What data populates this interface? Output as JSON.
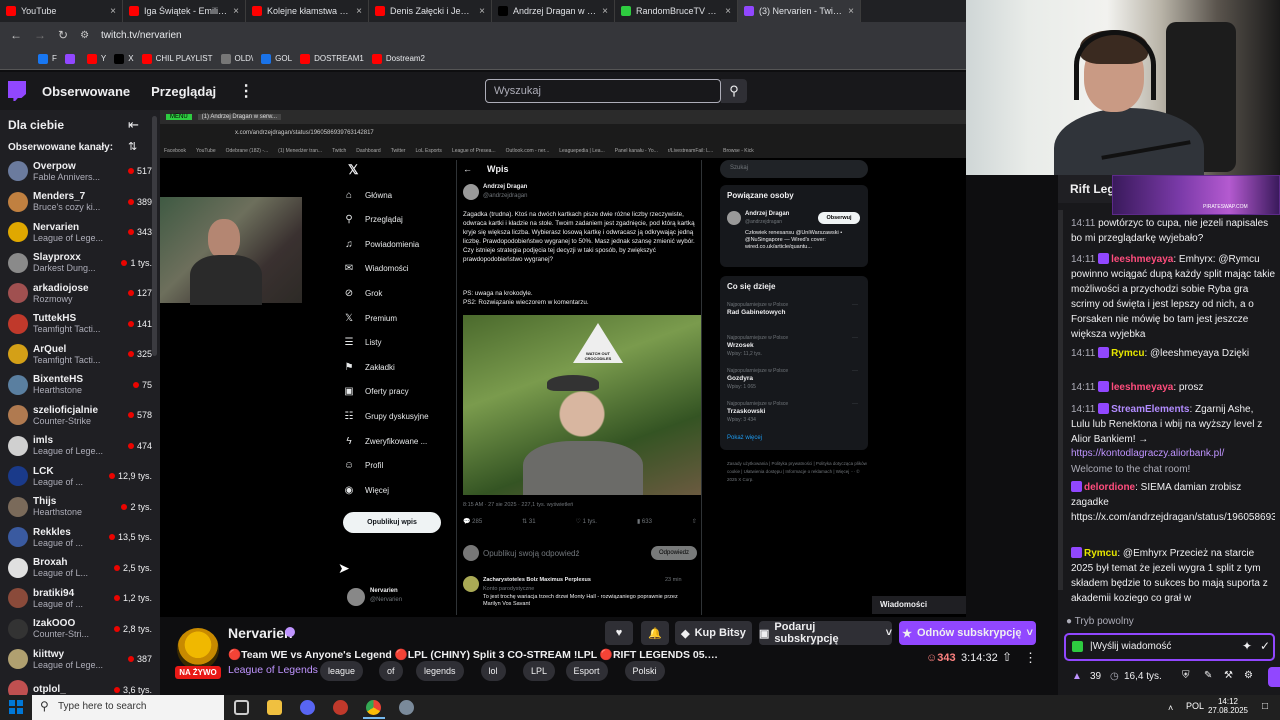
{
  "browser": {
    "tabs": [
      {
        "title": "YouTube",
        "color": "#ff0000"
      },
      {
        "title": "Iga Świątek - Emiliana Ara...",
        "color": "#ff0000"
      },
      {
        "title": "Kolejne kłamstwa koalicji...",
        "color": "#ff0000"
      },
      {
        "title": "Denis Załęcki i Jego Chor...",
        "color": "#ff0000"
      },
      {
        "title": "Andrzej Dragan w serwisie...",
        "color": "#000000"
      },
      {
        "title": "RandomBruceTV Stream ...",
        "color": "#2ecc40"
      },
      {
        "title": "(3) Nervarien - Twitch",
        "color": "#9147ff"
      }
    ],
    "url": "twitch.tv/nervarien",
    "bookmarks": [
      "F",
      "",
      "Y",
      "X",
      "CHIL PLAYLIST",
      "OLD\\",
      "GOL",
      "DOSTREAM1",
      "Dostream2"
    ]
  },
  "twitch": {
    "nav": {
      "following": "Obserwowane",
      "browse": "Przeglądaj",
      "search_placeholder": "Wyszukaj"
    },
    "sidebar": {
      "title": "Dla ciebie",
      "section": "Obserwowane kanały:",
      "channels": [
        {
          "name": "Overpow",
          "game": "Fable Annivers...",
          "viewers": "517",
          "color": "#6b7b9e"
        },
        {
          "name": "Menders_7",
          "game": "Bruce's cozy ki...",
          "viewers": "389",
          "color": "#c08040"
        },
        {
          "name": "Nervarien",
          "game": "League of Lege...",
          "viewers": "343",
          "color": "#e0a800"
        },
        {
          "name": "Slayproxx",
          "game": "Darkest Dung...",
          "viewers": "1 tys.",
          "color": "#8a8a8a"
        },
        {
          "name": "arkadiojose",
          "game": "Rozmowy",
          "viewers": "127",
          "color": "#a05050"
        },
        {
          "name": "TuttekHS",
          "game": "Teamfight Tacti...",
          "viewers": "141",
          "color": "#c0392b"
        },
        {
          "name": "ArQuel",
          "game": "Teamfight Tacti...",
          "viewers": "325",
          "color": "#d4a017"
        },
        {
          "name": "BixenteHS",
          "game": "Hearthstone",
          "viewers": "75",
          "color": "#5a7fa0"
        },
        {
          "name": "szelioficjalnie",
          "game": "Counter-Strike",
          "viewers": "578",
          "color": "#b07a50"
        },
        {
          "name": "imls",
          "game": "League of Lege...",
          "viewers": "474",
          "color": "#d0d0d0"
        },
        {
          "name": "LCK",
          "game": "League of ...",
          "viewers": "12,9 tys.",
          "color": "#1a3a8a"
        },
        {
          "name": "Thijs",
          "game": "Hearthstone",
          "viewers": "2 tys.",
          "color": "#7a6a5a"
        },
        {
          "name": "Rekkles",
          "game": "League of ...",
          "viewers": "13,5 tys.",
          "color": "#3a5aa0"
        },
        {
          "name": "Broxah",
          "game": "League of L...",
          "viewers": "2,5 tys.",
          "color": "#e0e0e0"
        },
        {
          "name": "bratiki94",
          "game": "League of ...",
          "viewers": "1,2 tys.",
          "color": "#8a4a3a"
        },
        {
          "name": "IzakOOO",
          "game": "Counter-Stri...",
          "viewers": "2,8 tys.",
          "color": "#333333"
        },
        {
          "name": "kiittwy",
          "game": "League of Lege...",
          "viewers": "387",
          "color": "#b0a070"
        },
        {
          "name": "otplol_",
          "game": "",
          "viewers": "3,6 tys.",
          "color": "#c05050"
        }
      ]
    },
    "stream_content": {
      "inner_url": "x.com/andrzejdragan/status/1960586939763142817",
      "inner_tabs": [
        "MENU",
        "(1) Andrzej Dragan w serw..."
      ],
      "inner_bookmarks": [
        "Facebook",
        "YouTube",
        "Odebrane (182) -...",
        "(1) Menedżer tran...",
        "Twitch",
        "Dashboard",
        "Twitter",
        "LoL Esports",
        "League of Presea...",
        "Outlook.com - ner...",
        "Leaguepedia | Lea...",
        "Panel kanału - Yo...",
        "r/LivestreamFail: L...",
        "Browse - Kick"
      ],
      "x_nav": [
        "Główna",
        "Przeglądaj",
        "Powiadomienia",
        "Wiadomości",
        "Grok",
        "Premium",
        "Listy",
        "Zakładki",
        "Oferty pracy",
        "Grupy dyskusyjne",
        "Zweryfikowane ...",
        "Profil",
        "Więcej"
      ],
      "x_nav_icons": [
        "home-icon",
        "search-icon",
        "bell-icon",
        "mail-icon",
        "grok-icon",
        "x-icon",
        "list-icon",
        "bookmark-icon",
        "briefcase-icon",
        "people-icon",
        "bolt-icon",
        "user-icon",
        "more-icon"
      ],
      "post_button": "Opublikuj wpis",
      "profile_name": "Nervarien",
      "profile_handle": "@Nervarien",
      "tweet": {
        "header": "Wpis",
        "author": "Andrzej Dragan",
        "handle": "@andrzejdragan",
        "body": "Zagadka (trudna). Ktoś na dwóch kartkach pisze dwie różne liczby rzeczywiste, odwraca kartki i kładzie na stole. Twoim zadaniem jest zgadnięcie, pod którą kartką kryje się większa liczba. Wybierasz losową kartkę i odwracasz ją odkrywając jedną liczbę. Prawdopodobieństwo wygranej to 50%. Masz jednak szansę zmienić wybór. Czy istnieje strategia podjęcia tej decyzji w taki sposób, by zwiększyć prawdopodobieństwo wygranej?",
        "ps": "PS: uwaga na krokodyle.",
        "ps2": "PS2: Rozwiązanie wieczorem w komentarzu.",
        "sign": "WATCH OUT CROCODILES",
        "meta": "8:15 AM · 27 sie 2025 · 227,1 tys. wyświetleń",
        "stats": [
          "285",
          "31",
          "1 tys.",
          "633"
        ],
        "reply_placeholder": "Opublikuj swoją odpowiedź",
        "reply_button": "Odpowiedz",
        "reply_author": "Zacharystoteles Bolz Maximus Perplexus",
        "reply_time": "23 min",
        "reply_sub": "Konto parodystyczne",
        "reply_text": "To jest trochę wariacja trzech drzwi Monty Hall - rozwiązaniego poprawnie przez Marilyn Vos Savant"
      },
      "right": {
        "search": "Szukaj",
        "related_title": "Powiązane osoby",
        "related_name": "Andrzej Dragan",
        "related_handle": "@andrzejdragan",
        "related_desc": "Człowiek renesansu @UniWarszawski • @NuSingapore — Wired's cover: wired.co.uk/article/quantu...",
        "follow": "Obserwuj",
        "trends_title": "Co się dzieje",
        "trends": [
          {
            "cat": "Najpopularniejsze w Polsce",
            "name": "Rad Gabinetowych",
            "posts": ""
          },
          {
            "cat": "Najpopularniejsze w Polsce",
            "name": "Wrzosek",
            "posts": "Wpisy: 11,2 tys."
          },
          {
            "cat": "Najpopularniejsze w Polsce",
            "name": "Gozdyra",
            "posts": "Wpisy: 1 065"
          },
          {
            "cat": "Najpopularniejsze w Polsce",
            "name": "Trzaskowski",
            "posts": "Wpisy: 3 434"
          }
        ],
        "show_more": "Pokaż więcej",
        "footer": "Zasady użytkowania | Polityka prywatności | Polityka dotycząca plików cookie | Ułatwienia dostępu | Informacje o reklamach | Więcej ··· © 2025 X Corp."
      },
      "messages_label": "Wiadomości"
    },
    "channel": {
      "name": "Nervarien",
      "live": "NA ŻYWO",
      "title": "🔴Team WE vs Anyone's Legend 🔴LPL (CHINY) Split 3 CO-STREAM !LPL 🔴RIFT LEGENDS 05.09 !RL !MAR 🔴",
      "game": "League of Legends",
      "tags": [
        "league",
        "of",
        "legends",
        "lol",
        "LPL",
        "Esport",
        "Polski"
      ],
      "viewers": "343",
      "uptime": "3:14:32",
      "bits": "Kup Bitsy",
      "gift": "Podaruj subskrypcję",
      "renew": "Odnów subskrypcję"
    },
    "chat": {
      "rift_label": "Rift Leg",
      "overlay_text": "PIRATESWAP.COM",
      "messages": [
        {
          "time": "14:11",
          "user": "",
          "text": "powtórzyc to cupa, nie jezeli napisales bo mi przeglądarkę wyjebało?",
          "ucolor": "#efeff1"
        },
        {
          "time": "14:11",
          "user": "leeshmeyaya",
          "text": ": Emhyrx: @Rymcu powinno wciągać dupą każdy split mając takie możliwości a przychodzi sobie Ryba gra scrimy od święta i jest lepszy od nich, a o Forsaken nie mówię bo tam jest jeszcze większa wyjebka",
          "ucolor": "#ff4d7d"
        },
        {
          "time": "14:11",
          "user": "Rymcu",
          "text": ": @leeshmeyaya Dzięki",
          "ucolor": "#e6e600"
        },
        {
          "time": "14:11",
          "user": "leeshmeyaya",
          "text": ": prosz",
          "ucolor": "#ff4d7d"
        },
        {
          "time": "14:11",
          "user": "StreamElements",
          "text": ": Zgarnij Ashe, Lulu lub Renektona i wbij na wyższy level z Alior Bankiem! →",
          "ucolor": "#b28cff"
        },
        {
          "time": "",
          "user": "",
          "text": "https://kontodlagraczy.aliorbank.pl/",
          "ucolor": "#bf94ff"
        },
        {
          "time": "",
          "user": "",
          "text": "Welcome to the chat room!",
          "ucolor": "#adadb8"
        },
        {
          "time": "",
          "user": "delordione",
          "text": ": SIEMA damian zrobisz zagadke https://x.com/andrzejdragan/status/1960586939763142817",
          "ucolor": "#ff4d7d"
        },
        {
          "time": "",
          "user": "Rymcu",
          "text": ": @Emhyrx Przecież na starcie 2025 był temat że jezeli wygra 1 split z tym składem będzie to sukces bo mają suporta z akademii koziego co grał w",
          "ucolor": "#e6e600"
        }
      ],
      "slow_mode": "Tryb powolny",
      "input_placeholder": "|Wyślij wiadomość",
      "points": "39",
      "watch_time": "16,4 tys."
    }
  },
  "taskbar": {
    "search": "Type here to search",
    "lang": "POL",
    "time": "14:12",
    "date": "27.08.2025"
  }
}
